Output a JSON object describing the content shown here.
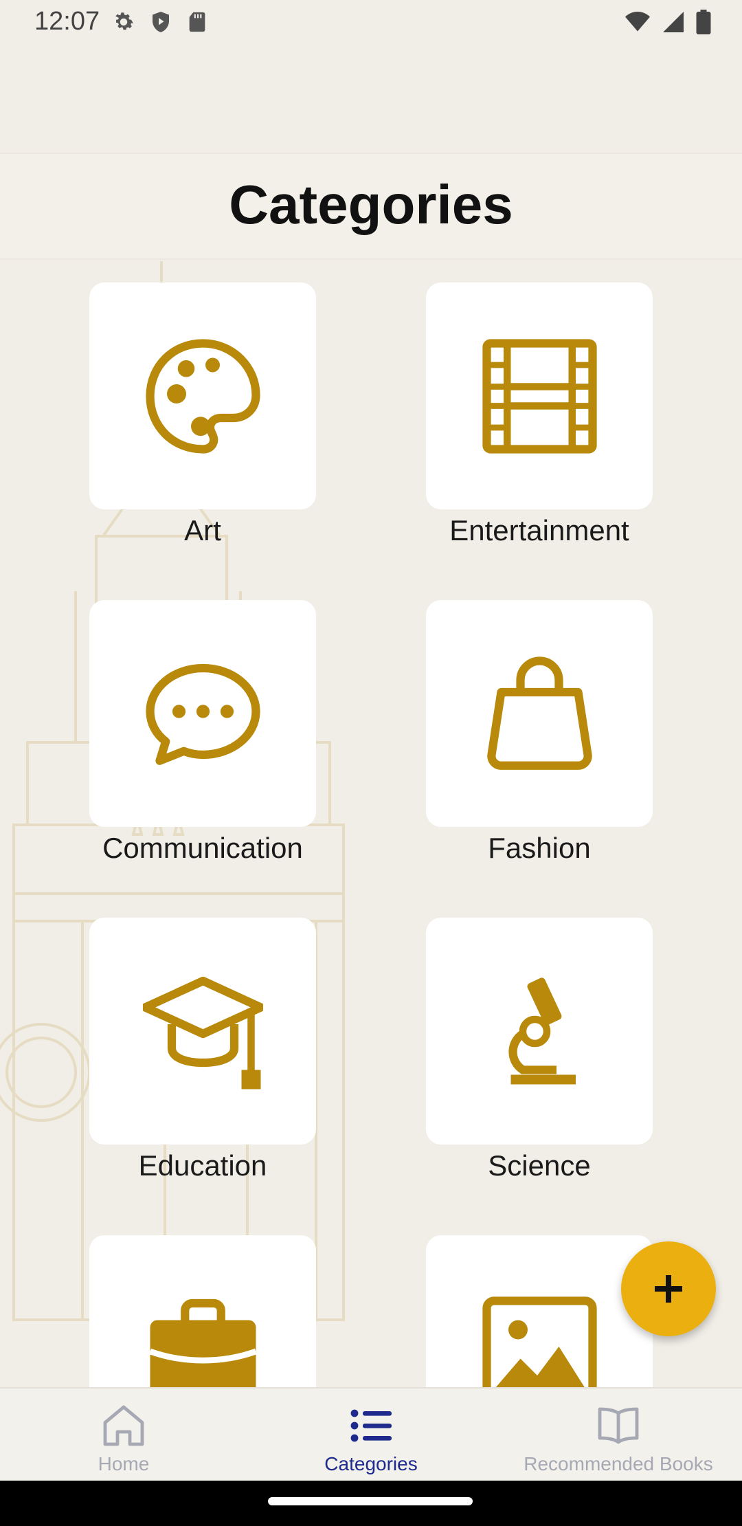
{
  "status_bar": {
    "time": "12:07",
    "left_icons": [
      "gear-icon",
      "shield-play-icon",
      "sd-card-icon"
    ],
    "right_icons": [
      "wifi-icon",
      "signal-icon",
      "battery-icon"
    ]
  },
  "header": {
    "title": "Categories"
  },
  "colors": {
    "accent": "#B8890A",
    "fab": "#ECAF10",
    "nav_active": "#1E2A8C",
    "nav_inactive": "#A6A8B3"
  },
  "categories": [
    {
      "label": "Art",
      "icon": "palette-icon"
    },
    {
      "label": "Entertainment",
      "icon": "film-icon"
    },
    {
      "label": "Communication",
      "icon": "chat-bubble-icon"
    },
    {
      "label": "Fashion",
      "icon": "shopping-bag-icon"
    },
    {
      "label": "Education",
      "icon": "graduation-cap-icon"
    },
    {
      "label": "Science",
      "icon": "microscope-icon"
    },
    {
      "label": "",
      "icon": "briefcase-icon"
    },
    {
      "label": "",
      "icon": "image-icon"
    }
  ],
  "fab": {
    "icon": "plus-icon"
  },
  "bottom_nav": {
    "items": [
      {
        "label": "Home",
        "icon": "home-icon",
        "active": false
      },
      {
        "label": "Categories",
        "icon": "list-icon",
        "active": true
      },
      {
        "label": "Recommended Books",
        "icon": "book-icon",
        "active": false
      }
    ]
  }
}
